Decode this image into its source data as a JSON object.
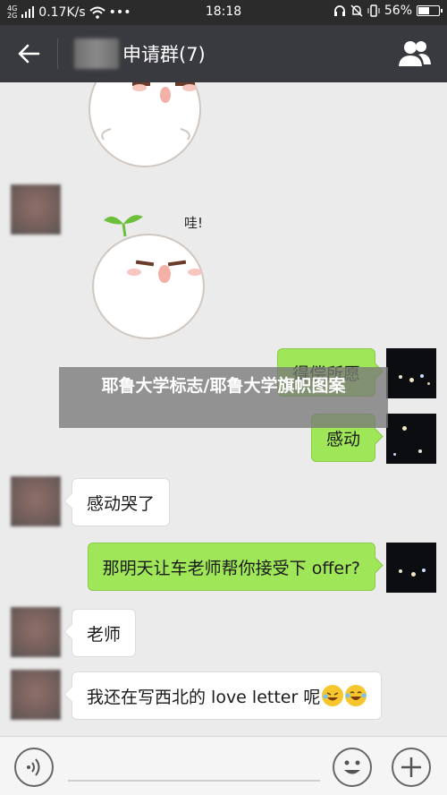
{
  "status_bar": {
    "network_top": "4G",
    "network_bottom": "2G",
    "speed": "0.17K/s",
    "overflow": "•••",
    "time": "18:18",
    "battery": "56%",
    "battery_level": 0.56
  },
  "header": {
    "title": "申请群(7)"
  },
  "stickers": [
    {
      "caption": ""
    },
    {
      "caption": "哇!"
    }
  ],
  "messages": [
    {
      "side": "right",
      "text": "得偿所愿"
    },
    {
      "side": "right",
      "text": "感动"
    },
    {
      "side": "left",
      "text": "感动哭了"
    },
    {
      "side": "right",
      "text": "那明天让车老师帮你接受下 offer?"
    },
    {
      "side": "left",
      "text": "老师"
    },
    {
      "side": "left",
      "text": "我还在写西北的 love letter 呢"
    }
  ],
  "overlay": {
    "text": "耶鲁大学标志/耶鲁大学旗帜图案"
  }
}
